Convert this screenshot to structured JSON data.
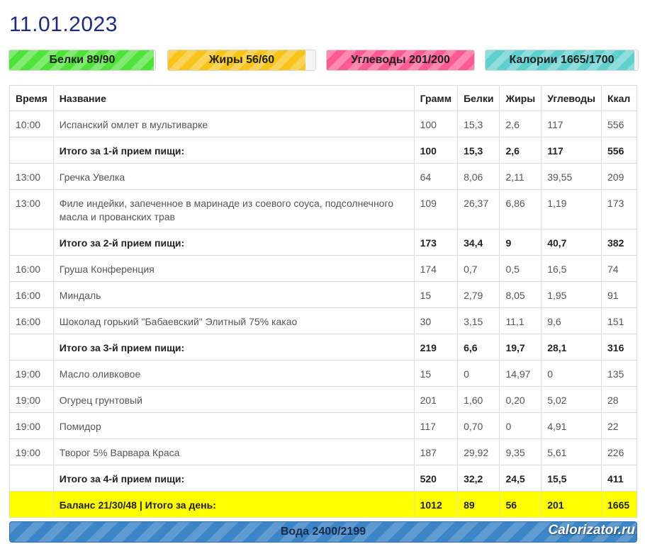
{
  "date": "11.01.2023",
  "bars": {
    "protein": {
      "label": "Белки 89/90",
      "color": "#4fe23a",
      "progress": 0.989
    },
    "fat": {
      "label": "Жиры 56/60",
      "color": "#f7c419",
      "progress": 0.933
    },
    "carbs": {
      "label": "Углеводы 201/200",
      "color": "#ff5a93",
      "progress": 1.0
    },
    "kcal": {
      "label": "Калории 1665/1700",
      "color": "#5fd0cd",
      "progress": 0.979
    }
  },
  "table": {
    "headers": [
      "Время",
      "Название",
      "Грамм",
      "Белки",
      "Жиры",
      "Углеводы",
      "Ккал"
    ],
    "rows": [
      {
        "type": "item",
        "cells": [
          "10:00",
          "Испанский омлет в мультиварке",
          "100",
          "15,3",
          "2,6",
          "117",
          "556"
        ]
      },
      {
        "type": "total",
        "cells": [
          "",
          "Итого за 1-й прием пищи:",
          "100",
          "15,3",
          "2,6",
          "117",
          "556"
        ]
      },
      {
        "type": "item",
        "cells": [
          "13:00",
          "Гречка Увелка",
          "64",
          "8,06",
          "2,11",
          "39,55",
          "209"
        ]
      },
      {
        "type": "item",
        "tall": true,
        "cells": [
          "13:00",
          "Филе индейки, запеченное в маринаде из соевого соуса, подсолнечного масла и прованских трав",
          "109",
          "26,37",
          "6,86",
          "1,19",
          "173"
        ]
      },
      {
        "type": "total",
        "cells": [
          "",
          "Итого за 2-й прием пищи:",
          "173",
          "34,4",
          "9",
          "40,7",
          "382"
        ]
      },
      {
        "type": "item",
        "cells": [
          "16:00",
          "Груша Конференция",
          "174",
          "0,7",
          "0,5",
          "16,5",
          "74"
        ]
      },
      {
        "type": "item",
        "cells": [
          "16:00",
          "Миндаль",
          "15",
          "2,79",
          "8,05",
          "1,95",
          "91"
        ]
      },
      {
        "type": "item",
        "cells": [
          "16:00",
          "Шоколад горький \"Бабаевский\" Элитный 75% какао",
          "30",
          "3,15",
          "11,1",
          "9,6",
          "151"
        ]
      },
      {
        "type": "total",
        "cells": [
          "",
          "Итого за 3-й прием пищи:",
          "219",
          "6,6",
          "19,7",
          "28,1",
          "316"
        ]
      },
      {
        "type": "item",
        "cells": [
          "19:00",
          "Масло оливковое",
          "15",
          "0",
          "14,97",
          "0",
          "135"
        ]
      },
      {
        "type": "item",
        "cells": [
          "19:00",
          "Огурец грунтовый",
          "201",
          "1,60",
          "0,20",
          "5,02",
          "28"
        ]
      },
      {
        "type": "item",
        "cells": [
          "19:00",
          "Помидор",
          "117",
          "0,70",
          "0",
          "4,91",
          "22"
        ]
      },
      {
        "type": "item",
        "cells": [
          "19:00",
          "Творог 5% Варвара Краса",
          "187",
          "29,92",
          "9,35",
          "5,61",
          "226"
        ]
      },
      {
        "type": "total",
        "cells": [
          "",
          "Итого за 4-й прием пищи:",
          "520",
          "32,2",
          "24,5",
          "15,5",
          "411"
        ]
      },
      {
        "type": "grand",
        "cells": [
          "",
          "Баланс 21/30/48 | Итого за день:",
          "1012",
          "89",
          "56",
          "201",
          "1665"
        ]
      }
    ]
  },
  "water": {
    "label": "Вода 2400/2199",
    "color": "#3c85c6",
    "progress": 1.0
  },
  "watermark": "Calorizator.ru"
}
